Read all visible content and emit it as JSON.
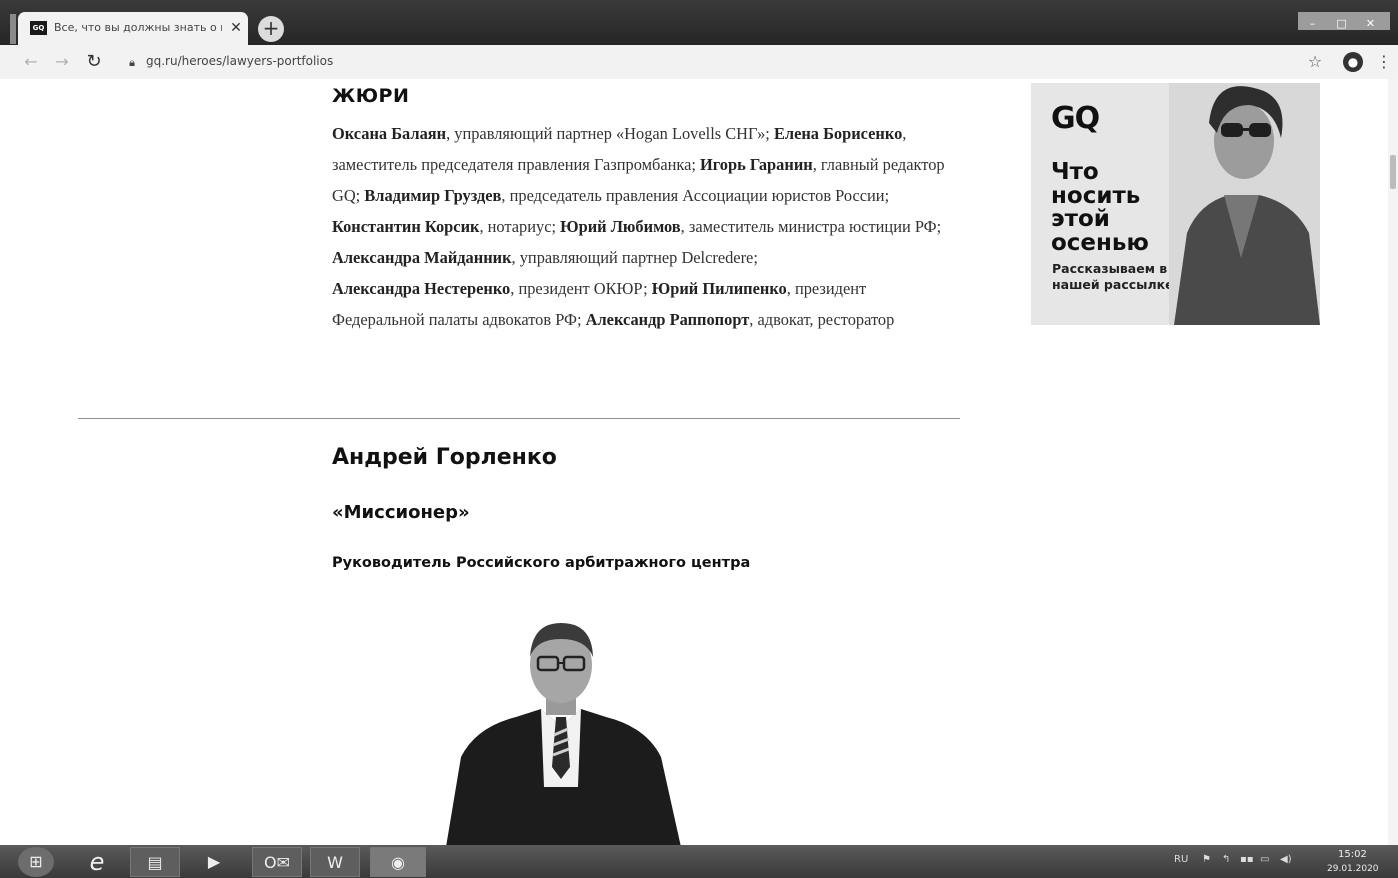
{
  "browser": {
    "tab_title": "Все, что вы должны знать о пр",
    "tab_favicon": "GQ",
    "url": "gq.ru/heroes/lawyers-portfolios"
  },
  "jury": {
    "heading": "ЖЮРИ",
    "members": [
      {
        "name": "Оксана Балаян",
        "role": ", управляющий партнер «Hogan Lovells СНГ»; "
      },
      {
        "name": "Елена Борисенко",
        "role": ", заместитель председателя правления Газпромбанка; "
      },
      {
        "name": "Игорь Гаранин",
        "role": ", главный редактор GQ; "
      },
      {
        "name": "Владимир Груздев",
        "role": ", председатель правления Ассоциации юристов России; "
      },
      {
        "name": "Константин Корсик",
        "role": ", нотариус; "
      },
      {
        "name": "Юрий Любимов",
        "role": ", заместитель министра юстиции РФ; "
      },
      {
        "name": "Александра Майданник",
        "role": ", управляющий партнер Delcredere; "
      },
      {
        "name": "Александра Нестеренко",
        "role": ", президент ОКЮР; "
      },
      {
        "name": "Юрий Пилипенко",
        "role": ", президент Федеральной палаты адвокатов РФ; "
      },
      {
        "name": "Александр Раппопорт",
        "role": ", адвокат, ресторатор"
      }
    ]
  },
  "profile": {
    "name": "Андрей Горленко",
    "nomination": "«Миссионер»",
    "position": "Руководитель Российского арбитражного центра"
  },
  "ad": {
    "logo": "GQ",
    "headline": "Что носить этой осенью",
    "subtext": "Рассказываем в нашей рассылке"
  },
  "taskbar": {
    "lang": "RU",
    "time": "15:02",
    "date": "29.01.2020"
  }
}
